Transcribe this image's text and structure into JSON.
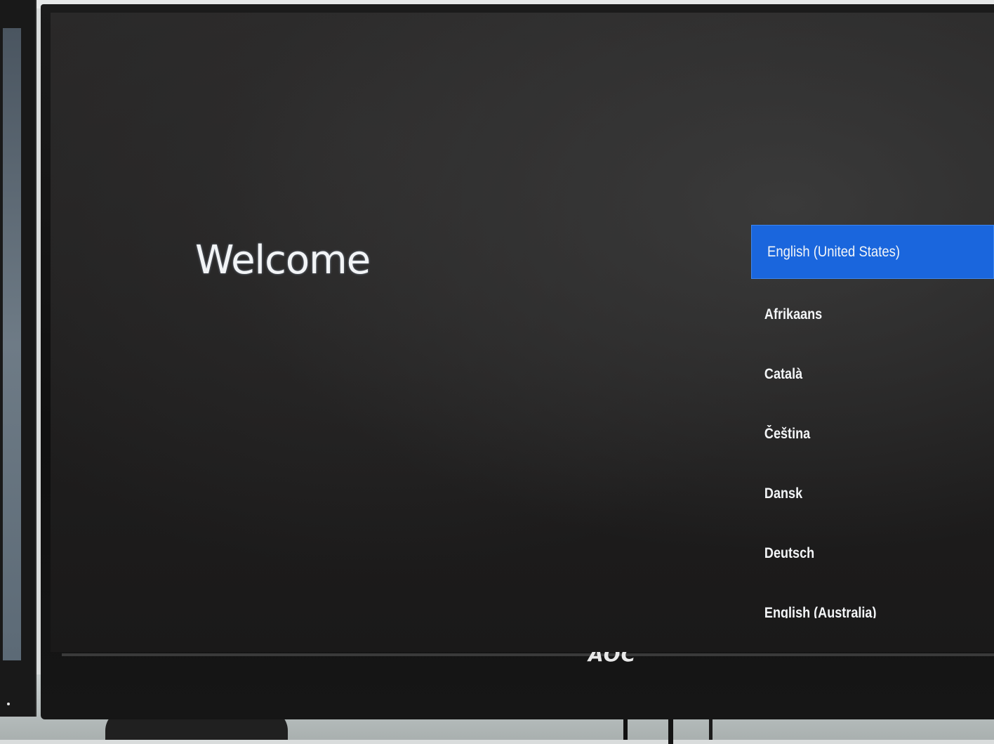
{
  "screen": {
    "title": "Welcome",
    "languages": [
      {
        "label": "English (United States)",
        "selected": true
      },
      {
        "label": "Afrikaans",
        "selected": false
      },
      {
        "label": "Català",
        "selected": false
      },
      {
        "label": "Čeština",
        "selected": false
      },
      {
        "label": "Dansk",
        "selected": false
      },
      {
        "label": "Deutsch",
        "selected": false
      },
      {
        "label": "English (Australia)",
        "selected": false
      }
    ],
    "selected_color": "#1a66dd",
    "background_color": "#232222"
  },
  "monitor": {
    "brand": "AOC"
  }
}
